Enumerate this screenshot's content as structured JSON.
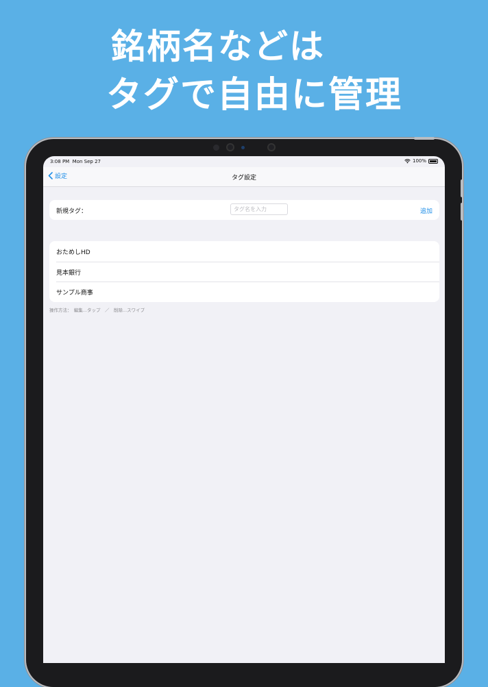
{
  "headline": {
    "line1": "銘柄名などは",
    "line2": "タグで自由に管理"
  },
  "status_bar": {
    "time": "3:08 PM",
    "date": "Mon Sep 27",
    "battery": "100%"
  },
  "nav": {
    "back_label": "設定",
    "title": "タグ設定"
  },
  "new_tag": {
    "label": "新規タグ：",
    "placeholder": "タグ名を入力",
    "add_label": "追加"
  },
  "tags": [
    {
      "name": "おためしHD"
    },
    {
      "name": "見本銀行"
    },
    {
      "name": "サンプル商事"
    }
  ],
  "help_text": "操作方法：　編集...タップ　／　削除...スワイプ",
  "colors": {
    "background": "#5ab0e6",
    "accent": "#1e8ee8"
  }
}
